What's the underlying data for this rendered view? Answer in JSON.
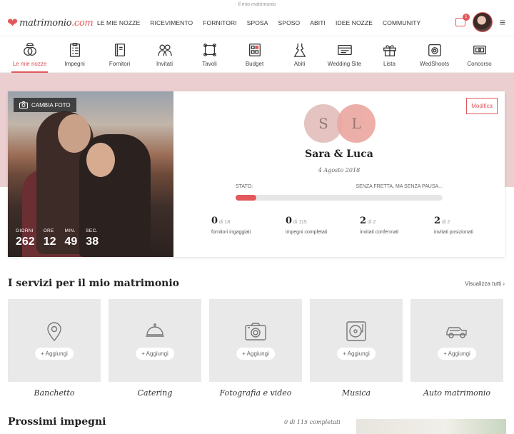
{
  "topstrip": "Il mio matrimonio",
  "brand": {
    "name": "matrimonio",
    "tld": ".com",
    "accent": "#e2585b"
  },
  "nav": [
    "LE MIE NOZZE",
    "RICEVIMENTO",
    "FORNITORI",
    "SPOSA",
    "SPOSO",
    "ABITI",
    "IDEE NOZZE",
    "COMMUNITY"
  ],
  "inbox_badge": "1",
  "tools": [
    {
      "label": "Le mie nozze",
      "icon": "rings-icon",
      "active": true
    },
    {
      "label": "Impegni",
      "icon": "checklist-icon"
    },
    {
      "label": "Fornitori",
      "icon": "notebook-icon"
    },
    {
      "label": "Invitati",
      "icon": "guests-icon"
    },
    {
      "label": "Tavoli",
      "icon": "table-icon"
    },
    {
      "label": "Budget",
      "icon": "calculator-icon"
    },
    {
      "label": "Abiti",
      "icon": "dress-icon"
    },
    {
      "label": "Wedding Site",
      "icon": "website-icon"
    },
    {
      "label": "Lista",
      "icon": "gift-icon"
    },
    {
      "label": "WedShoots",
      "icon": "camera-icon"
    },
    {
      "label": "Concorso",
      "icon": "ticket-icon"
    }
  ],
  "hero": {
    "change_photo": "CAMBIA FOTO",
    "countdown": [
      {
        "label": "GIORNI",
        "value": "262"
      },
      {
        "label": "ORE",
        "value": "12"
      },
      {
        "label": "MIN.",
        "value": "49"
      },
      {
        "label": "SEC.",
        "value": "38"
      }
    ],
    "edit": "Modifica",
    "initials": [
      "S",
      "L"
    ],
    "names": "Sara & Luca",
    "date": "4 Agosto 2018",
    "status_label": "STATO:",
    "status_text": "SENZA FRETTA, MA SENZA PAUSA...",
    "progress": 0.1,
    "stats": [
      {
        "value": "0",
        "total": "di 18",
        "desc": "fornitori ingaggiati"
      },
      {
        "value": "0",
        "total": "di 115",
        "desc": "impegni completati"
      },
      {
        "value": "2",
        "total": "di 2",
        "desc": "invitati confermati"
      },
      {
        "value": "2",
        "total": "di 2",
        "desc": "invitati posizionati"
      }
    ]
  },
  "services": {
    "title": "I servizi per il mio matrimonio",
    "see_all": "Visualizza tutti ›",
    "add_label": "+ Aggiungi",
    "items": [
      {
        "name": "Banchetto",
        "icon": "location-pin-icon"
      },
      {
        "name": "Catering",
        "icon": "cloche-icon"
      },
      {
        "name": "Fotografia e video",
        "icon": "camera-icon"
      },
      {
        "name": "Musica",
        "icon": "turntable-icon"
      },
      {
        "name": "Auto matrimonio",
        "icon": "car-icon"
      }
    ]
  },
  "upcoming": {
    "title": "Prossimi impegni",
    "count": "0 di 115 completati"
  }
}
